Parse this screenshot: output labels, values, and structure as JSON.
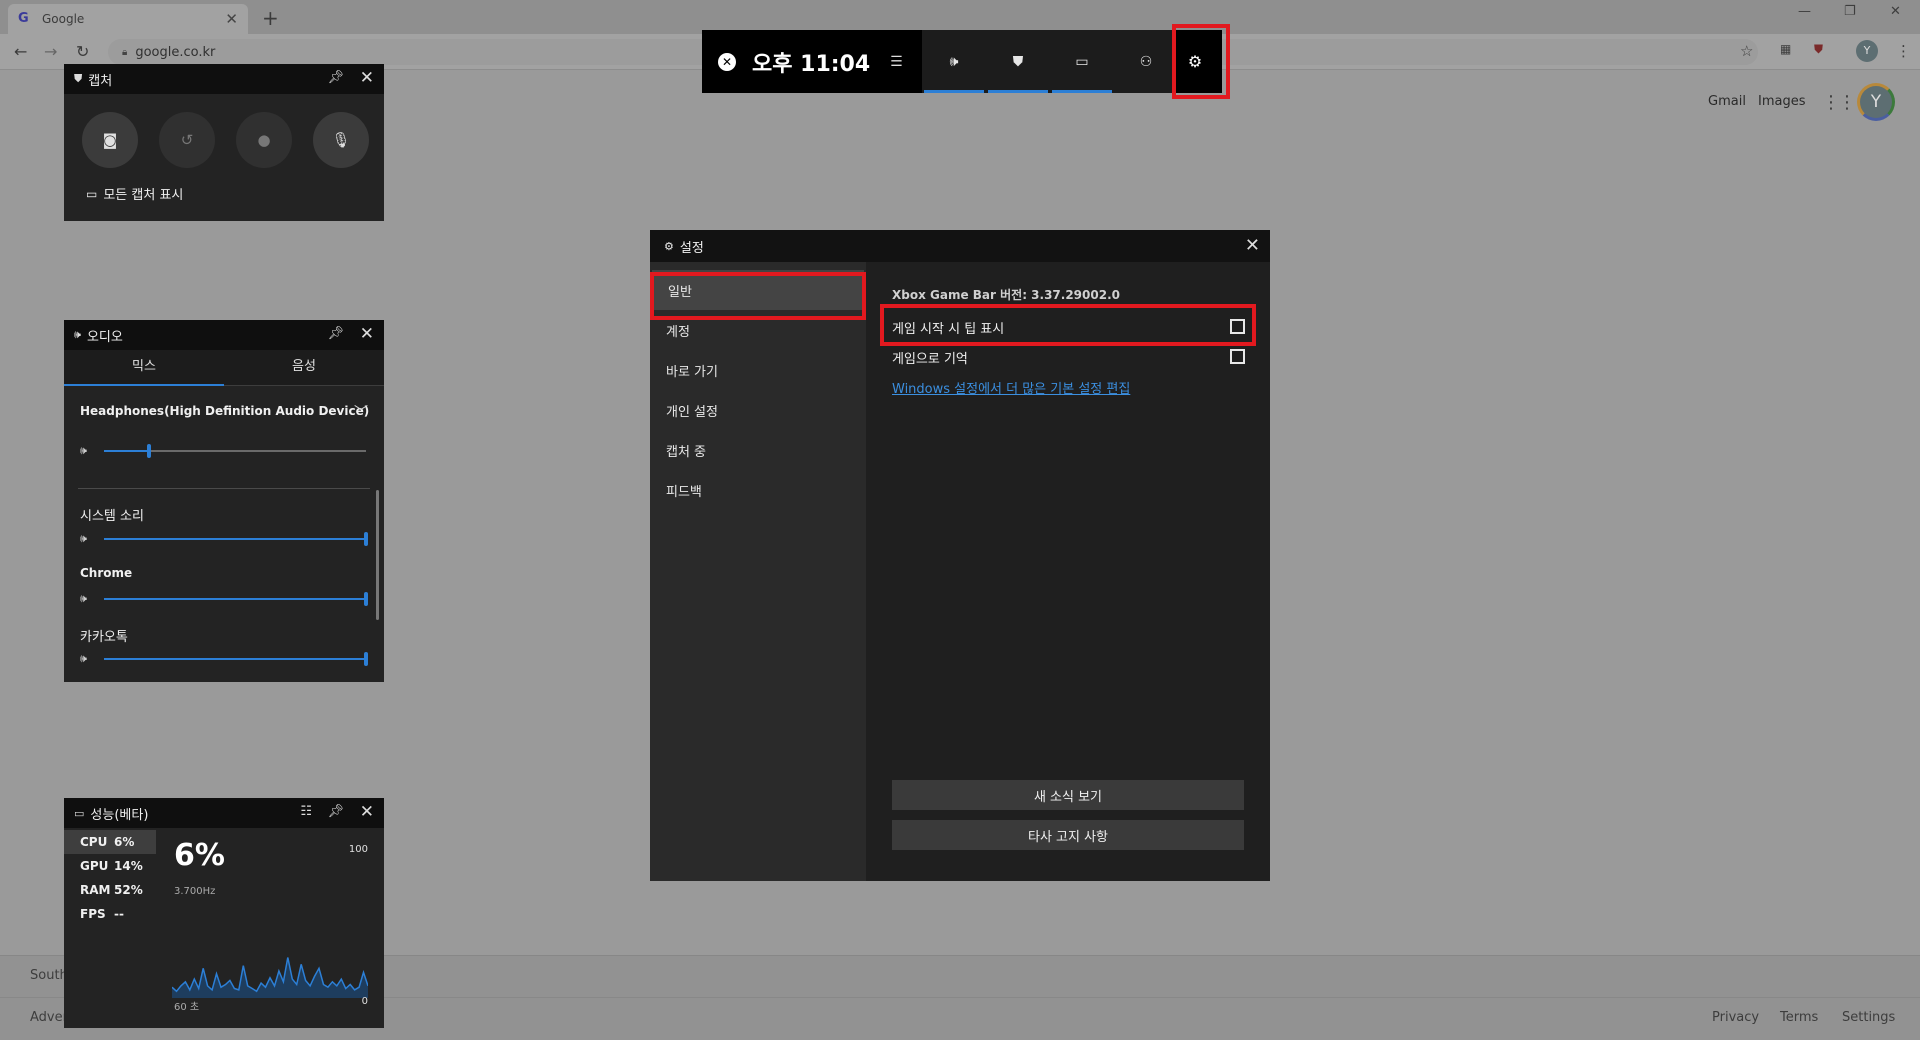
{
  "browser": {
    "tab_title": "Google",
    "tab_favicon": "G",
    "url": "google.co.kr",
    "profile_initial": "Y",
    "header_links": [
      "Gmail",
      "Images"
    ],
    "footer_country": "South",
    "footer_left": "Adver",
    "footer_links": [
      "Privacy",
      "Terms",
      "Settings"
    ]
  },
  "gamebar": {
    "time": "오후 11:04",
    "widgets": [
      "audio-icon",
      "capture-icon",
      "performance-icon",
      "xbox-social-icon"
    ],
    "settings_icon": "gear-icon"
  },
  "capture": {
    "title": "캡처",
    "show_all": "모든 캡처 표시"
  },
  "audio": {
    "title": "오디오",
    "tabs": [
      "믹스",
      "음성"
    ],
    "device": "Headphones(High Definition Audio Device)",
    "device_volume": 0.17,
    "apps": [
      {
        "name": "시스템 소리",
        "volume": 1.0
      },
      {
        "name": "Chrome",
        "volume": 1.0
      },
      {
        "name": "카카오톡",
        "volume": 1.0
      }
    ]
  },
  "performance": {
    "title": "성능(베타)",
    "rows": [
      {
        "key": "CPU",
        "value": "6%"
      },
      {
        "key": "GPU",
        "value": "14%"
      },
      {
        "key": "RAM",
        "value": "52%"
      },
      {
        "key": "FPS",
        "value": "--"
      }
    ],
    "big_value": "6%",
    "frequency": "3.700Hz",
    "max_label": "100",
    "time_label": "60 초",
    "min_label": "0",
    "cpu_history": [
      8,
      5,
      9,
      12,
      6,
      14,
      7,
      22,
      9,
      6,
      18,
      8,
      10,
      13,
      7,
      6,
      24,
      9,
      7,
      5,
      11,
      8,
      15,
      9,
      20,
      12,
      30,
      14,
      10,
      25,
      13,
      9,
      16,
      22,
      10,
      8,
      12,
      9,
      14,
      7,
      10,
      6,
      8,
      19,
      9
    ]
  },
  "settings": {
    "title": "설정",
    "nav": [
      "일반",
      "계정",
      "바로 가기",
      "개인 설정",
      "캡처 중",
      "피드백"
    ],
    "version": "Xbox Game Bar 버전: 3.37.29002.0",
    "options": [
      {
        "label": "게임 시작 시 팁 표시",
        "checked": false
      },
      {
        "label": "게임으로 기억",
        "checked": false
      }
    ],
    "link": "Windows 설정에서 더 많은 기본 설정 편집",
    "buttons": [
      "새 소식 보기",
      "타사 고지 사항"
    ]
  },
  "colors": {
    "accent": "#2c7fd6",
    "highlight": "#e2191f",
    "link": "#3b8fe0"
  }
}
